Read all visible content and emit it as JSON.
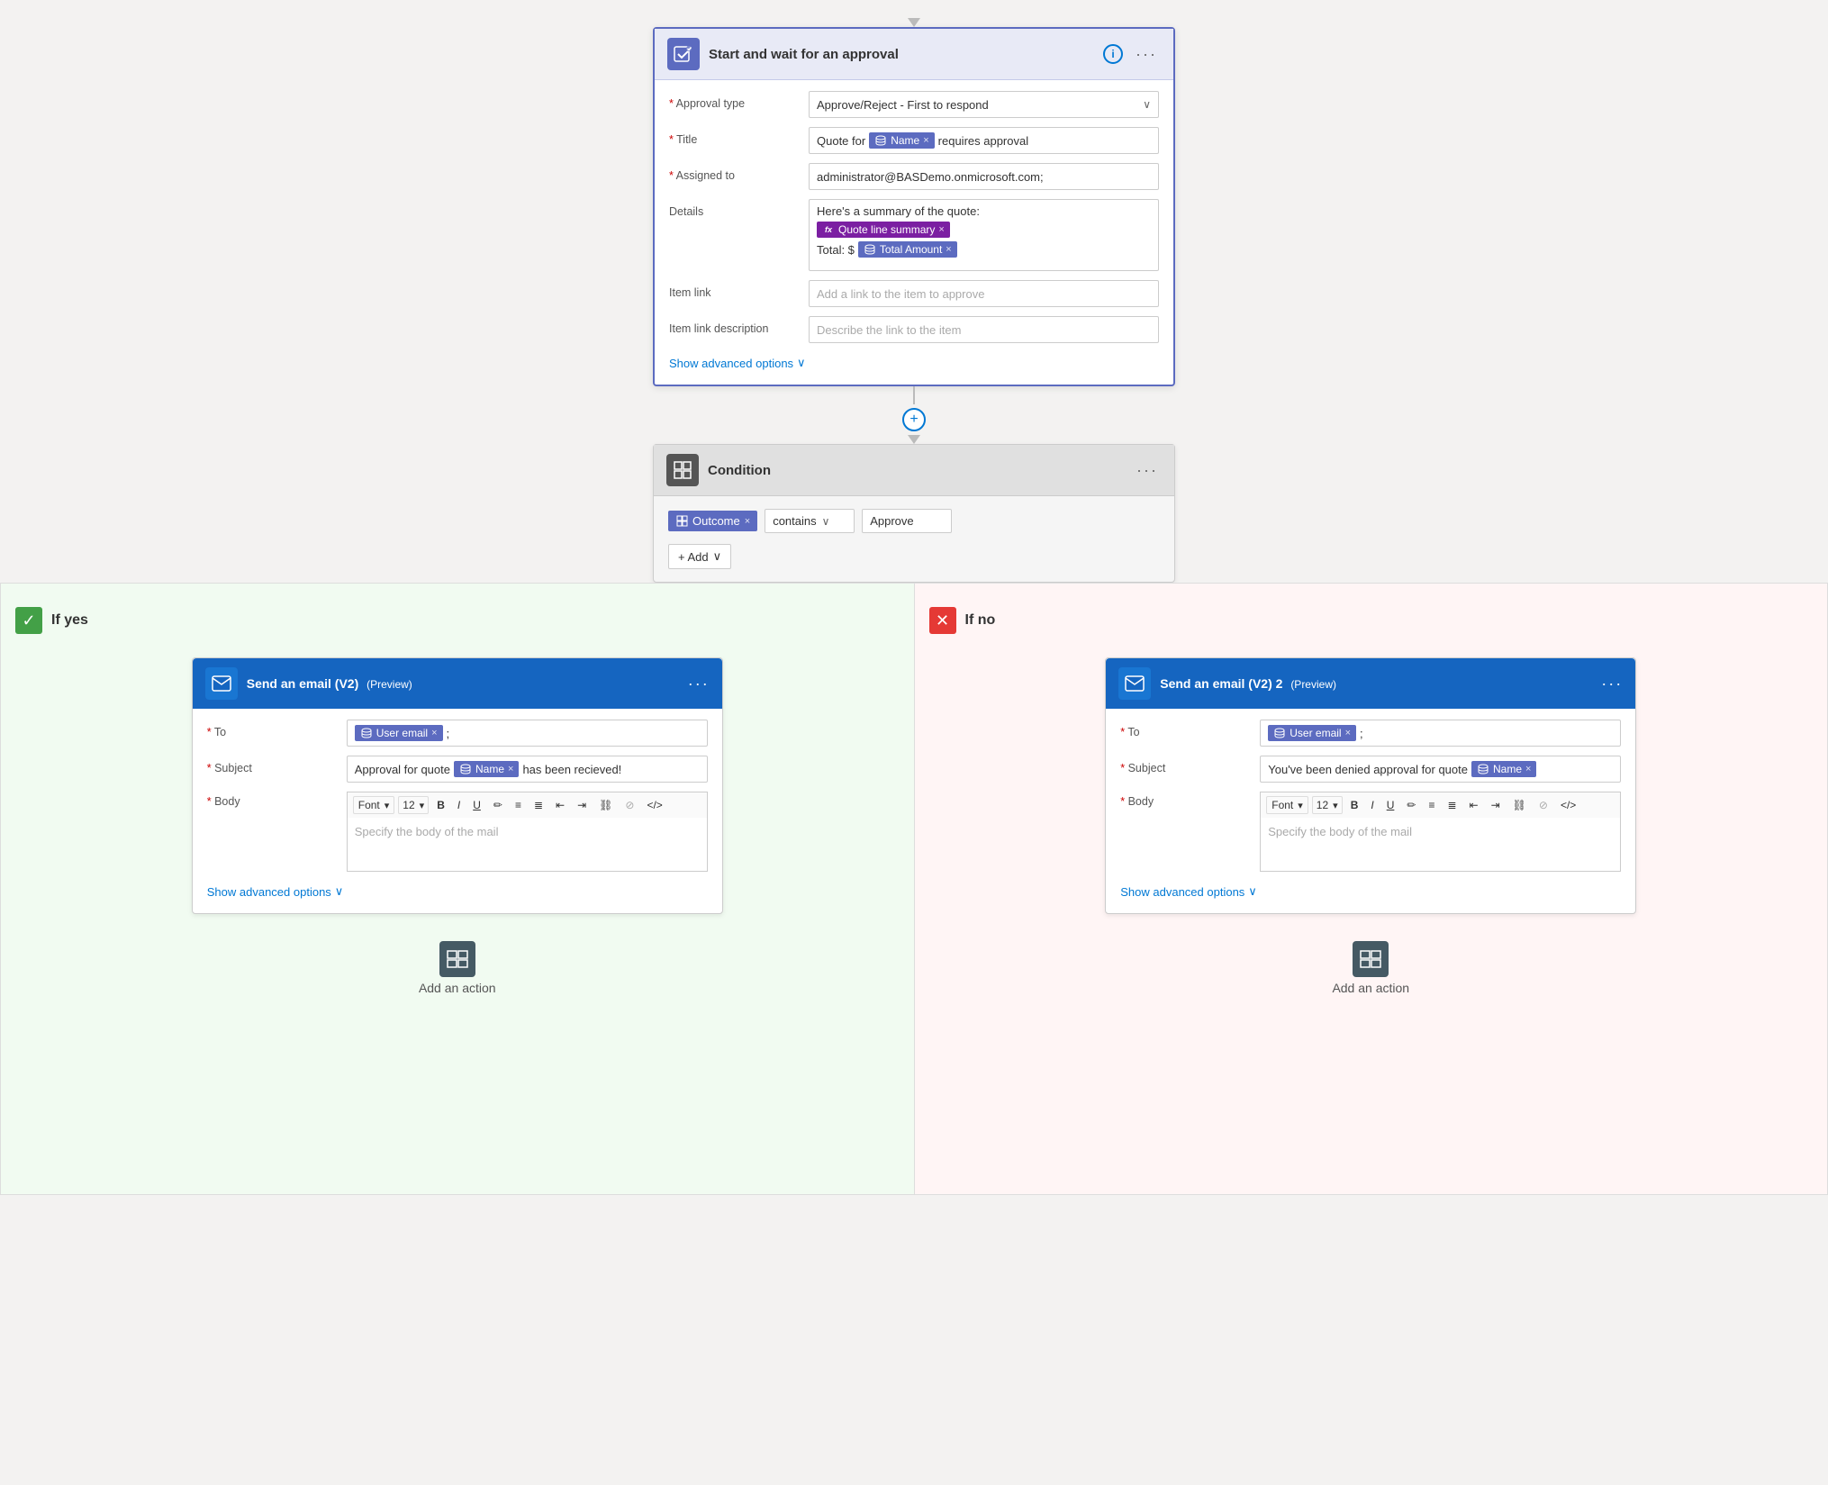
{
  "connectors": {
    "down_arrow": "▼",
    "plus": "+"
  },
  "approval_card": {
    "title": "Start and wait for an approval",
    "icon_symbol": "✓",
    "info_symbol": "i",
    "dots": "···",
    "fields": {
      "approval_type": {
        "label": "Approval type",
        "value": "Approve/Reject - First to respond",
        "required": true
      },
      "title": {
        "label": "Title",
        "required": true,
        "prefix": "Quote for",
        "token_label": "Name",
        "suffix": "requires approval"
      },
      "assigned_to": {
        "label": "Assigned to",
        "required": true,
        "value": "administrator@BASDemo.onmicrosoft.com;"
      },
      "details": {
        "label": "Details",
        "line1": "Here's a summary of the quote:",
        "token1_label": "Quote line summary",
        "line2": "Total: $",
        "token2_label": "Total Amount"
      },
      "item_link": {
        "label": "Item link",
        "placeholder": "Add a link to the item to approve"
      },
      "item_link_desc": {
        "label": "Item link description",
        "placeholder": "Describe the link to the item"
      }
    },
    "show_advanced": "Show advanced options",
    "show_advanced_chevron": "∨"
  },
  "condition_card": {
    "title": "Condition",
    "icon_symbol": "⊞",
    "dots": "···",
    "token_label": "Outcome",
    "operator": "contains",
    "value": "Approve",
    "add_label": "+ Add",
    "add_chevron": "∨"
  },
  "branch_yes": {
    "label": "If yes",
    "check": "✓",
    "email_card": {
      "title": "Send an email (V2)",
      "preview": "(Preview)",
      "dots": "···",
      "icon": "✉",
      "fields": {
        "to": {
          "label": "To",
          "required": true,
          "token_label": "User email",
          "suffix": ";"
        },
        "subject": {
          "label": "Subject",
          "required": true,
          "prefix": "Approval for quote",
          "token_label": "Name",
          "suffix": "has been recieved!"
        },
        "body": {
          "label": "Body",
          "required": true,
          "placeholder": "Specify the body of the mail",
          "font_label": "Font",
          "size_label": "12"
        }
      },
      "show_advanced": "Show advanced options",
      "show_advanced_chevron": "∨"
    },
    "add_action": "Add an action"
  },
  "branch_no": {
    "label": "If no",
    "x": "✕",
    "email_card": {
      "title": "Send an email (V2) 2",
      "preview": "(Preview)",
      "dots": "···",
      "icon": "✉",
      "fields": {
        "to": {
          "label": "To",
          "required": true,
          "token_label": "User email",
          "suffix": ";"
        },
        "subject": {
          "label": "Subject",
          "required": true,
          "prefix": "You've been denied approval for quote",
          "token_label": "Name"
        },
        "body": {
          "label": "Body",
          "required": true,
          "placeholder": "Specify the body of the mail",
          "font_label": "Font",
          "size_label": "12"
        }
      },
      "show_advanced": "Show advanced options",
      "show_advanced_chevron": "∨"
    },
    "add_action": "Add an action"
  },
  "toolbar": {
    "bold": "B",
    "italic": "I",
    "underline": "U",
    "pen": "✏",
    "list_ul": "≡",
    "list_ol": "≣",
    "indent_l": "⇤",
    "indent_r": "⇥",
    "link": "⛓",
    "unlink": "⊘",
    "code": "</>",
    "chevron": "▾"
  },
  "add_action_icon": "≡"
}
